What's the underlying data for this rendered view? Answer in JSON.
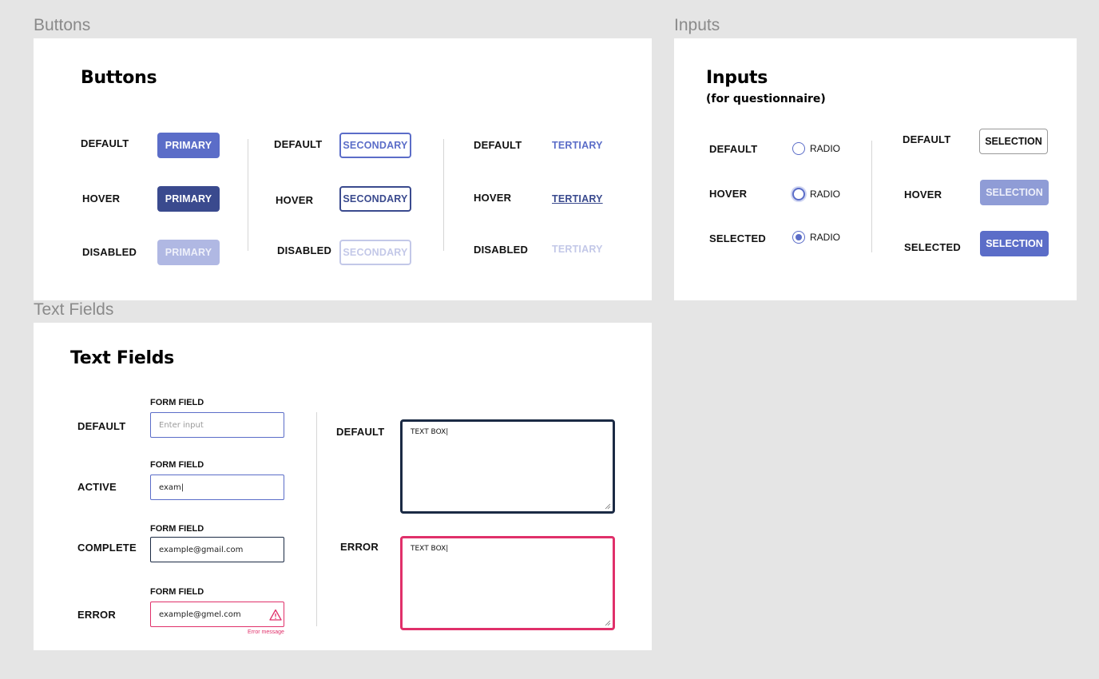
{
  "frames": {
    "buttons": "Buttons",
    "inputs": "Inputs",
    "text_fields": "Text Fields"
  },
  "buttons_panel": {
    "title": "Buttons",
    "states": {
      "default": "DEFAULT",
      "hover": "HOVER",
      "disabled": "DISABLED"
    },
    "primary": "PRIMARY",
    "secondary": "SECONDARY",
    "tertiary": "TERTIARY"
  },
  "inputs_panel": {
    "title": "Inputs",
    "subtitle": "(for questionnaire)",
    "states": {
      "default": "DEFAULT",
      "hover": "HOVER",
      "selected": "SELECTED"
    },
    "radio_label": "RADIO",
    "selection_label": "SELECTION"
  },
  "text_fields_panel": {
    "title": "Text Fields",
    "states": {
      "default": "DEFAULT",
      "active": "ACTIVE",
      "complete": "COMPLETE",
      "error": "ERROR"
    },
    "form_field_label": "FORM FIELD",
    "default_placeholder": "Enter input",
    "active_value": "exam|",
    "complete_value": "example@gmail.com",
    "error_value": "example@gmel.com",
    "error_message": "Error message",
    "textbox_value": "TEXT BOX|"
  },
  "colors": {
    "primary": "#5b6dc8",
    "primary_hover": "#3a4a8e",
    "primary_disabled": "#b0b8e3",
    "dark_border": "#1b2a44",
    "error": "#e0306a"
  },
  "icons": [
    "warning-triangle-icon",
    "resize-handle-icon"
  ]
}
